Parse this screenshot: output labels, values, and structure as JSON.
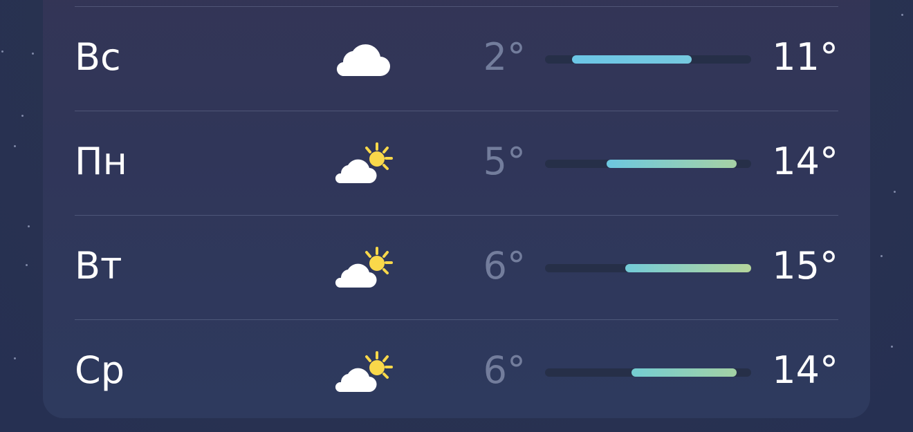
{
  "forecast": {
    "days": [
      {
        "day": "Вс",
        "icon": "cloud-icon",
        "low": "2°",
        "high": "11°",
        "range_start": 0.13,
        "range_end": 0.71,
        "colors": [
          "#6cc6e6",
          "#76c9df"
        ]
      },
      {
        "day": "Пн",
        "icon": "partly-sunny-icon",
        "low": "5°",
        "high": "14°",
        "range_start": 0.3,
        "range_end": 0.93,
        "colors": [
          "#6cc8e0",
          "#a6d1a4"
        ]
      },
      {
        "day": "Вт",
        "icon": "partly-sunny-icon",
        "low": "6°",
        "high": "15°",
        "range_start": 0.39,
        "range_end": 1.0,
        "colors": [
          "#73cbd8",
          "#b6d59b"
        ]
      },
      {
        "day": "Ср",
        "icon": "partly-sunny-icon",
        "low": "6°",
        "high": "14°",
        "range_start": 0.42,
        "range_end": 0.93,
        "colors": [
          "#74cdd2",
          "#a3d1a4"
        ]
      }
    ]
  },
  "colors": {
    "sun": "#f9d84a",
    "cloud": "#ffffff",
    "low_temp": "#737d9c",
    "track": "#262f48"
  }
}
